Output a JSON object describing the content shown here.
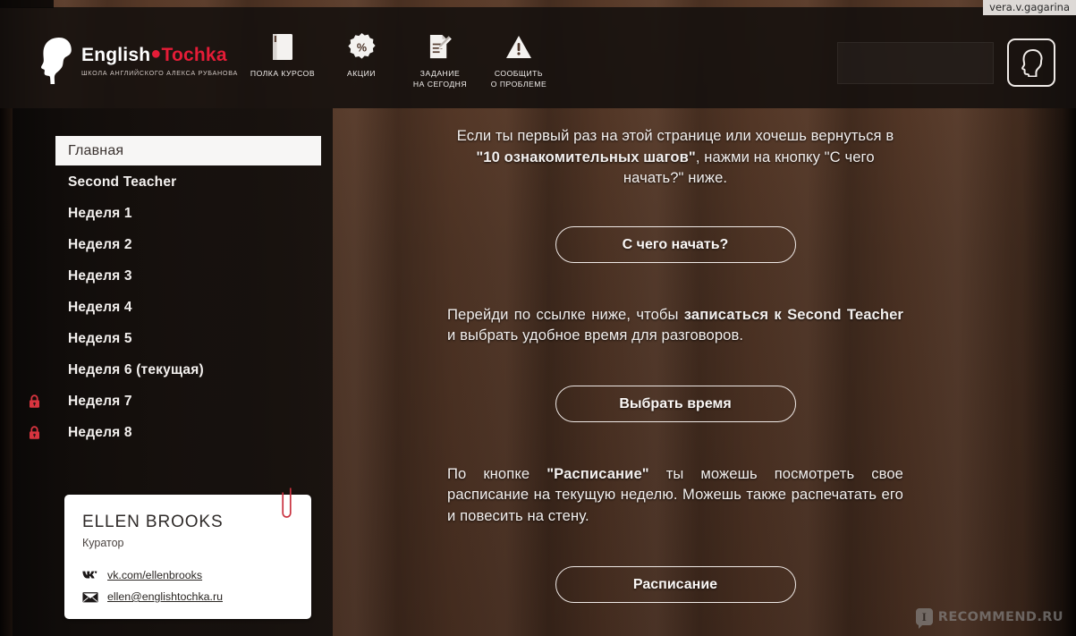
{
  "watermarks": {
    "user": "vera.v.gagarina",
    "site": "RECOMMEND.RU"
  },
  "header": {
    "logo": {
      "title_left": "English",
      "dot": "●",
      "title_right": "Tochka",
      "subtitle": "ШКОЛА АНГЛИЙСКОГО АЛЕКСА РУБАНОВА",
      "head_icon": "head-silhouette-icon"
    },
    "nav": [
      {
        "label": "ПОЛКА КУРСОВ",
        "icon": "book-icon"
      },
      {
        "label": "АКЦИИ",
        "icon": "percent-badge-icon"
      },
      {
        "label": "ЗАДАНИЕ\nНА СЕГОДНЯ",
        "icon": "document-pencil-icon"
      },
      {
        "label": "СООБЩИТЬ\nО ПРОБЛЕМЕ",
        "icon": "warning-triangle-icon"
      }
    ],
    "search": {
      "value": "",
      "placeholder": ""
    },
    "profile": {
      "icon": "profile-head-icon"
    }
  },
  "sidebar": {
    "items": [
      {
        "label": "Главная",
        "active": true,
        "locked": false
      },
      {
        "label": "Second Teacher",
        "active": false,
        "locked": false
      },
      {
        "label": "Неделя 1",
        "active": false,
        "locked": false
      },
      {
        "label": "Неделя 2",
        "active": false,
        "locked": false
      },
      {
        "label": "Неделя 3",
        "active": false,
        "locked": false
      },
      {
        "label": "Неделя 4",
        "active": false,
        "locked": false
      },
      {
        "label": "Неделя 5",
        "active": false,
        "locked": false
      },
      {
        "label": "Неделя 6 (текущая)",
        "active": false,
        "locked": false
      },
      {
        "label": "Неделя 7",
        "active": false,
        "locked": true
      },
      {
        "label": "Неделя 8",
        "active": false,
        "locked": true
      }
    ],
    "curator": {
      "name": "ELLEN BROOKS",
      "role": "Куратор",
      "vk": "vk.com/ellenbrooks",
      "email": "ellen@englishtochka.ru",
      "vk_icon": "vk-icon",
      "email_icon": "envelope-icon",
      "clip_icon": "paperclip-icon"
    }
  },
  "main": {
    "block1": {
      "text_a": "Если ты первый раз на этой странице или хочешь вернуться в ",
      "bold_a": "\"10 ознакомительных шагов\"",
      "text_b": ", нажми на кнопку \"С чего начать?\" ниже.",
      "button": "С чего начать?"
    },
    "block2": {
      "text_a": "Перейди по ссылке ниже, чтобы ",
      "bold_a": "записаться к Second Teacher",
      "text_b": " и выбрать удобное время для разговоров.",
      "button": "Выбрать время"
    },
    "block3": {
      "text_a": "По кнопке ",
      "bold_a": "\"Расписание\"",
      "text_b": " ты можешь посмотреть свое расписание на текущую неделю. Можешь также распечатать его и повесить на стену.",
      "button": "Расписание"
    }
  },
  "colors": {
    "brand_red": "#e51c37",
    "lock_red": "#d8343f",
    "wood": "#4d3324",
    "panel_dark": "#120e0c",
    "text_light": "#f3efed"
  }
}
